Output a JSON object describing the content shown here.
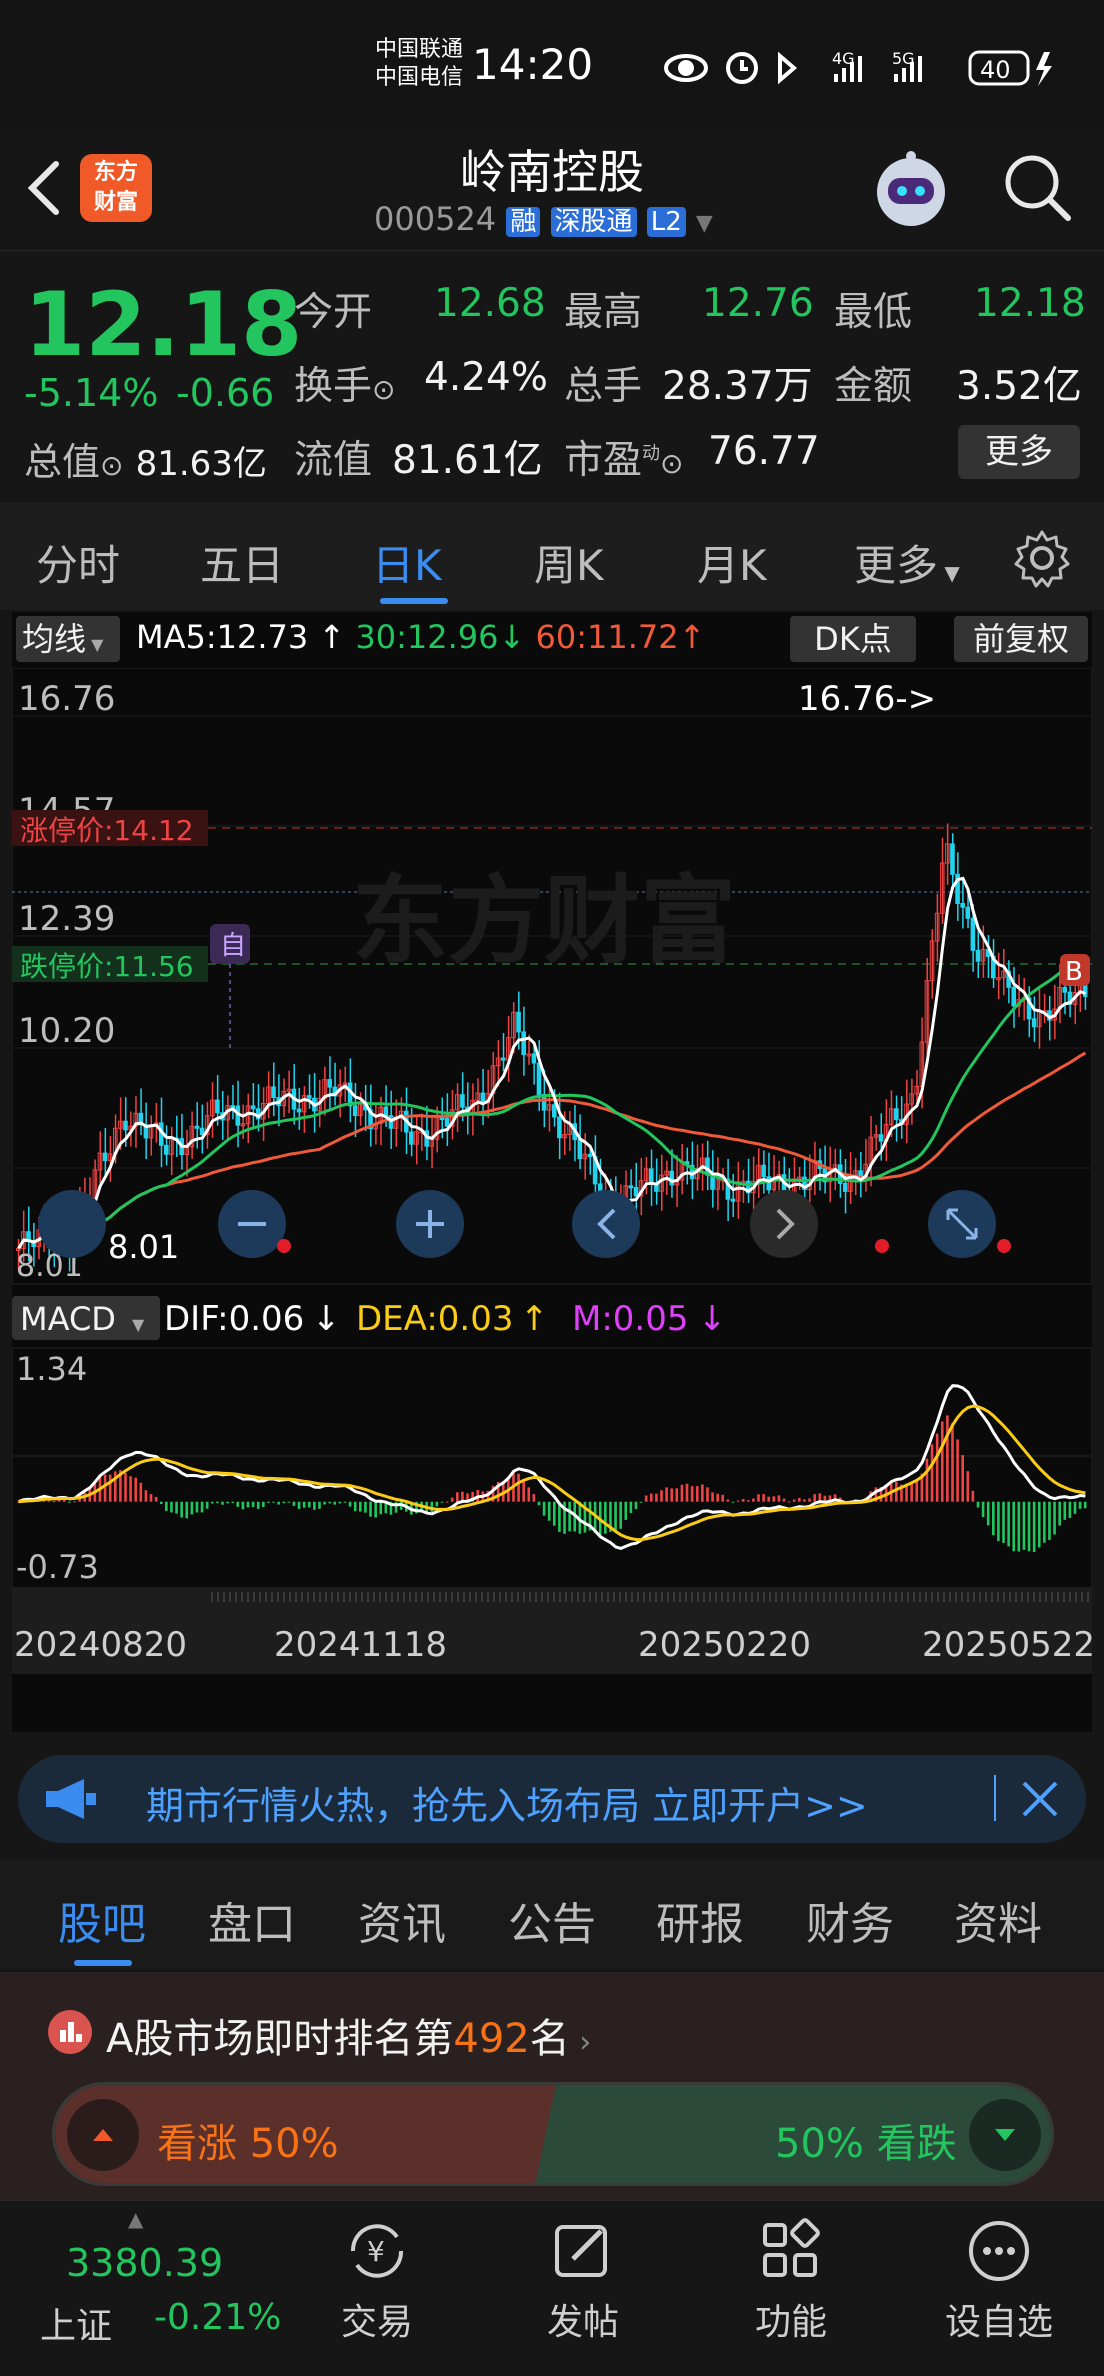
{
  "status_bar": {
    "carrier1": "中国联通",
    "carrier2": "中国电信",
    "time": "14:20",
    "battery": "40"
  },
  "header": {
    "logo_line1": "东方",
    "logo_line2": "财富",
    "stock_name": "岭南控股",
    "stock_code": "000524",
    "badge_rong": "融",
    "badge_sgt": "深股通",
    "badge_l2": "L2"
  },
  "quote": {
    "price": "12.18",
    "change_pct": "-5.14%",
    "change_amt": "-0.66",
    "open_label": "今开",
    "open": "12.68",
    "high_label": "最高",
    "high": "12.76",
    "low_label": "最低",
    "low": "12.18",
    "turnover_label": "换手",
    "turnover": "4.24%",
    "volume_label": "总手",
    "volume": "28.37万",
    "amount_label": "金额",
    "amount": "3.52亿",
    "mktcap_label": "总值",
    "mktcap": "81.63亿",
    "float_label": "流值",
    "float_cap": "81.61亿",
    "pe_label": "市盈",
    "pe_sup": "动",
    "pe": "76.77",
    "more_button": "更多"
  },
  "tabs": [
    "分时",
    "五日",
    "日K",
    "周K",
    "月K",
    "更多"
  ],
  "chart_toolbar": {
    "ma_button": "均线",
    "ma5": "MA5:12.73",
    "ma30": "30:12.96",
    "ma60": "60:11.72",
    "dk_button": "DK点",
    "adjust_button": "前复权"
  },
  "chart": {
    "y_ticks": [
      "16.76",
      "14.57",
      "12.39",
      "10.20"
    ],
    "limit_up_label": "涨停价:14.12",
    "limit_down_label": "跌停价:11.56",
    "high_marker": "16.76->",
    "low_marker": "8.01",
    "low_tick": "8.01",
    "self_marker": "自",
    "b_marker": "B",
    "watermark": "东方财富",
    "macd_button": "MACD",
    "dif": "DIF:0.06",
    "dea": "DEA:0.03",
    "m": "M:0.05",
    "macd_top": "1.34",
    "macd_bottom": "-0.73",
    "dates": [
      "20240820",
      "20241118",
      "20250220",
      "20250522"
    ],
    "colors": {
      "up": "#ef4444",
      "down": "#22d3ee",
      "ma5": "#ffffff",
      "ma30": "#22c55e",
      "ma60": "#ef5a3a",
      "dea": "#facc15",
      "m": "#e040fb"
    }
  },
  "chart_data": {
    "type": "candlestick",
    "ylim": [
      8.01,
      16.76
    ],
    "limit_up": 14.12,
    "limit_down": 11.56,
    "ma5_last": 12.73,
    "ma30_last": 12.96,
    "ma60_last": 11.72,
    "macd": {
      "dif": 0.06,
      "dea": 0.03,
      "m": 0.05,
      "ylim": [
        -0.73,
        1.34
      ]
    },
    "x_labels": [
      "20240820",
      "20241118",
      "20250220",
      "20250522"
    ]
  },
  "banner": {
    "text": "期市行情火热，抢先入场布局 立即开户>>"
  },
  "bottom_tabs": [
    "股吧",
    "盘口",
    "资讯",
    "公告",
    "研报",
    "财务",
    "资料"
  ],
  "rank": {
    "prefix": "A股市场即时排名第",
    "number": "492",
    "suffix": "名",
    "bull_label": "看涨 50%",
    "bear_label": "50% 看跌"
  },
  "bottom_nav": {
    "index_value": "3380.39",
    "index_name": "上证",
    "index_change": "-0.21%",
    "items": [
      "交易",
      "发帖",
      "功能",
      "设自选"
    ]
  }
}
